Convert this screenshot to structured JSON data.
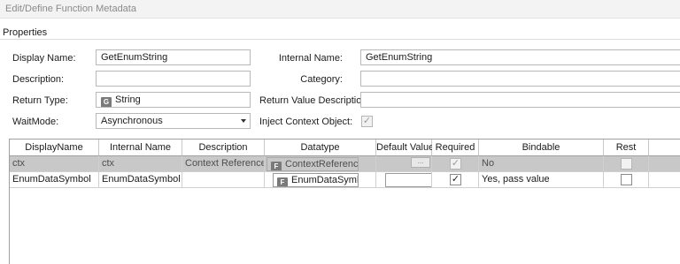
{
  "window": {
    "title": "Edit/Define Function Metadata"
  },
  "properties": {
    "group_label": "Properties",
    "display_name": {
      "label": "Display Name:",
      "value": "GetEnumString"
    },
    "internal_name": {
      "label": "Internal Name:",
      "value": "GetEnumString"
    },
    "description": {
      "label": "Description:",
      "value": ""
    },
    "category": {
      "label": "Category:",
      "value": ""
    },
    "return_type": {
      "label": "Return Type:",
      "badge": "G",
      "value": "String"
    },
    "return_value_description": {
      "label": "Return Value Description:",
      "value": ""
    },
    "wait_mode": {
      "label": "WaitMode:",
      "value": "Asynchronous"
    },
    "inject_context_object": {
      "label": "Inject Context Object:",
      "checked": true,
      "mark": "✓"
    }
  },
  "grid": {
    "columns": [
      "DisplayName",
      "Internal Name",
      "Description",
      "Datatype",
      "Default Value",
      "Required",
      "Bindable",
      "Rest"
    ],
    "rows": [
      {
        "display_name": "ctx",
        "internal_name": "ctx",
        "description": "Context Reference",
        "datatype_badge": "F",
        "datatype": "ContextReference",
        "default_value": "...",
        "required_mark": "✓",
        "bindable": "No",
        "rest_mark": ""
      },
      {
        "display_name": "EnumDataSymbol",
        "internal_name": "EnumDataSymbol",
        "description": "",
        "datatype_badge": "F",
        "datatype": "EnumDataSymbol",
        "default_value": "",
        "required_mark": "✓",
        "bindable": "Yes, pass value",
        "rest_mark": ""
      }
    ]
  },
  "icons": {
    "type_badge": "badge-icon",
    "dropdown": "chevron-down-icon",
    "checkbox": "checkmark-icon",
    "ellipsis": "ellipsis-button"
  },
  "colors": {
    "selected_row": "#c8c8c8",
    "titlebar_text": "#8a8a8a",
    "badge": "#7a7a7a"
  }
}
